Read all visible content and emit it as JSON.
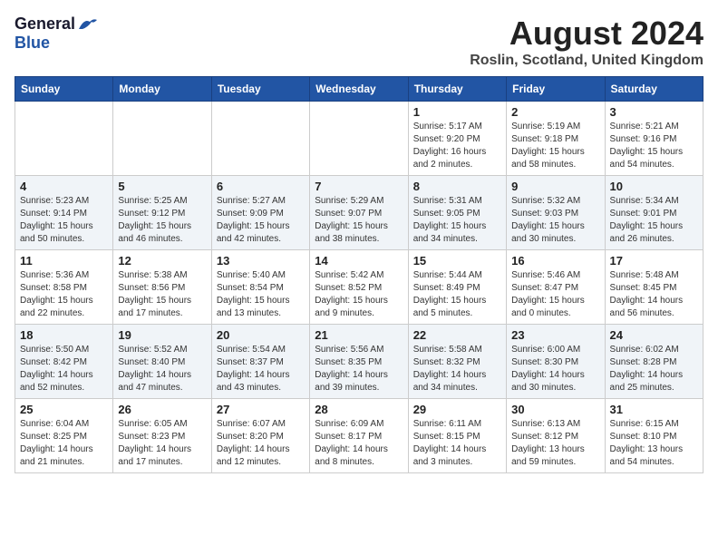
{
  "header": {
    "logo_general": "General",
    "logo_blue": "Blue",
    "title": "August 2024",
    "location": "Roslin, Scotland, United Kingdom"
  },
  "weekdays": [
    "Sunday",
    "Monday",
    "Tuesday",
    "Wednesday",
    "Thursday",
    "Friday",
    "Saturday"
  ],
  "weeks": [
    [
      {
        "day": "",
        "info": ""
      },
      {
        "day": "",
        "info": ""
      },
      {
        "day": "",
        "info": ""
      },
      {
        "day": "",
        "info": ""
      },
      {
        "day": "1",
        "info": "Sunrise: 5:17 AM\nSunset: 9:20 PM\nDaylight: 16 hours\nand 2 minutes."
      },
      {
        "day": "2",
        "info": "Sunrise: 5:19 AM\nSunset: 9:18 PM\nDaylight: 15 hours\nand 58 minutes."
      },
      {
        "day": "3",
        "info": "Sunrise: 5:21 AM\nSunset: 9:16 PM\nDaylight: 15 hours\nand 54 minutes."
      }
    ],
    [
      {
        "day": "4",
        "info": "Sunrise: 5:23 AM\nSunset: 9:14 PM\nDaylight: 15 hours\nand 50 minutes."
      },
      {
        "day": "5",
        "info": "Sunrise: 5:25 AM\nSunset: 9:12 PM\nDaylight: 15 hours\nand 46 minutes."
      },
      {
        "day": "6",
        "info": "Sunrise: 5:27 AM\nSunset: 9:09 PM\nDaylight: 15 hours\nand 42 minutes."
      },
      {
        "day": "7",
        "info": "Sunrise: 5:29 AM\nSunset: 9:07 PM\nDaylight: 15 hours\nand 38 minutes."
      },
      {
        "day": "8",
        "info": "Sunrise: 5:31 AM\nSunset: 9:05 PM\nDaylight: 15 hours\nand 34 minutes."
      },
      {
        "day": "9",
        "info": "Sunrise: 5:32 AM\nSunset: 9:03 PM\nDaylight: 15 hours\nand 30 minutes."
      },
      {
        "day": "10",
        "info": "Sunrise: 5:34 AM\nSunset: 9:01 PM\nDaylight: 15 hours\nand 26 minutes."
      }
    ],
    [
      {
        "day": "11",
        "info": "Sunrise: 5:36 AM\nSunset: 8:58 PM\nDaylight: 15 hours\nand 22 minutes."
      },
      {
        "day": "12",
        "info": "Sunrise: 5:38 AM\nSunset: 8:56 PM\nDaylight: 15 hours\nand 17 minutes."
      },
      {
        "day": "13",
        "info": "Sunrise: 5:40 AM\nSunset: 8:54 PM\nDaylight: 15 hours\nand 13 minutes."
      },
      {
        "day": "14",
        "info": "Sunrise: 5:42 AM\nSunset: 8:52 PM\nDaylight: 15 hours\nand 9 minutes."
      },
      {
        "day": "15",
        "info": "Sunrise: 5:44 AM\nSunset: 8:49 PM\nDaylight: 15 hours\nand 5 minutes."
      },
      {
        "day": "16",
        "info": "Sunrise: 5:46 AM\nSunset: 8:47 PM\nDaylight: 15 hours\nand 0 minutes."
      },
      {
        "day": "17",
        "info": "Sunrise: 5:48 AM\nSunset: 8:45 PM\nDaylight: 14 hours\nand 56 minutes."
      }
    ],
    [
      {
        "day": "18",
        "info": "Sunrise: 5:50 AM\nSunset: 8:42 PM\nDaylight: 14 hours\nand 52 minutes."
      },
      {
        "day": "19",
        "info": "Sunrise: 5:52 AM\nSunset: 8:40 PM\nDaylight: 14 hours\nand 47 minutes."
      },
      {
        "day": "20",
        "info": "Sunrise: 5:54 AM\nSunset: 8:37 PM\nDaylight: 14 hours\nand 43 minutes."
      },
      {
        "day": "21",
        "info": "Sunrise: 5:56 AM\nSunset: 8:35 PM\nDaylight: 14 hours\nand 39 minutes."
      },
      {
        "day": "22",
        "info": "Sunrise: 5:58 AM\nSunset: 8:32 PM\nDaylight: 14 hours\nand 34 minutes."
      },
      {
        "day": "23",
        "info": "Sunrise: 6:00 AM\nSunset: 8:30 PM\nDaylight: 14 hours\nand 30 minutes."
      },
      {
        "day": "24",
        "info": "Sunrise: 6:02 AM\nSunset: 8:28 PM\nDaylight: 14 hours\nand 25 minutes."
      }
    ],
    [
      {
        "day": "25",
        "info": "Sunrise: 6:04 AM\nSunset: 8:25 PM\nDaylight: 14 hours\nand 21 minutes."
      },
      {
        "day": "26",
        "info": "Sunrise: 6:05 AM\nSunset: 8:23 PM\nDaylight: 14 hours\nand 17 minutes."
      },
      {
        "day": "27",
        "info": "Sunrise: 6:07 AM\nSunset: 8:20 PM\nDaylight: 14 hours\nand 12 minutes."
      },
      {
        "day": "28",
        "info": "Sunrise: 6:09 AM\nSunset: 8:17 PM\nDaylight: 14 hours\nand 8 minutes."
      },
      {
        "day": "29",
        "info": "Sunrise: 6:11 AM\nSunset: 8:15 PM\nDaylight: 14 hours\nand 3 minutes."
      },
      {
        "day": "30",
        "info": "Sunrise: 6:13 AM\nSunset: 8:12 PM\nDaylight: 13 hours\nand 59 minutes."
      },
      {
        "day": "31",
        "info": "Sunrise: 6:15 AM\nSunset: 8:10 PM\nDaylight: 13 hours\nand 54 minutes."
      }
    ]
  ]
}
